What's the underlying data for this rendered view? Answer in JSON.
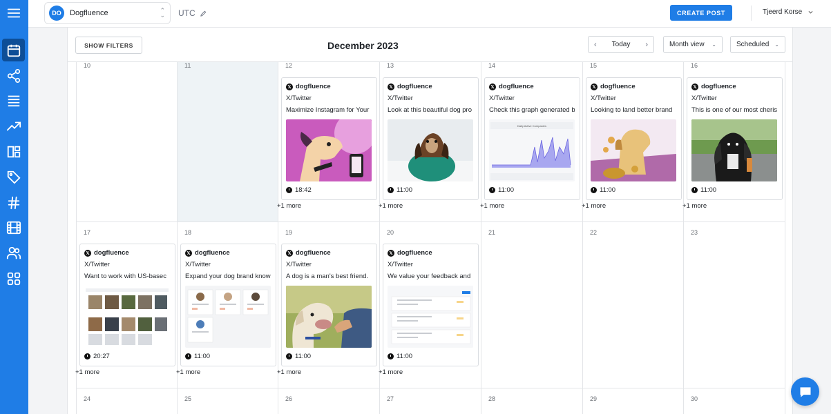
{
  "workspace": {
    "initials": "DO",
    "name": "Dogfluence"
  },
  "timezone": "UTC",
  "create_post_label": "CREATE POST",
  "user_name": "Tjeerd Korse",
  "header": {
    "show_filters": "SHOW FILTERS",
    "month_title": "December 2023",
    "today_label": "Today",
    "view_label": "Month view",
    "status_label": "Scheduled"
  },
  "weeks": [
    {
      "days": [
        {
          "num": "10"
        },
        {
          "num": "11",
          "today": true
        },
        {
          "num": "12",
          "post": {
            "account": "dogfluence",
            "network": "X/Twitter",
            "text": "Maximize Instagram for Your",
            "thumb": "pink-dog-phone",
            "time": "18:42"
          },
          "more": "+1 more"
        },
        {
          "num": "13",
          "post": {
            "account": "dogfluence",
            "network": "X/Twitter",
            "text": "Look at this beautiful dog pro",
            "thumb": "dachshund-sweater",
            "time": "11:00"
          },
          "more": "+1 more"
        },
        {
          "num": "14",
          "post": {
            "account": "dogfluence",
            "network": "X/Twitter",
            "text": "Check this graph generated b",
            "thumb": "graph",
            "time": "11:00"
          },
          "more": "+1 more"
        },
        {
          "num": "15",
          "post": {
            "account": "dogfluence",
            "network": "X/Twitter",
            "text": "Looking to land better brand",
            "thumb": "pink-dog-coins",
            "time": "11:00"
          },
          "more": "+1 more"
        },
        {
          "num": "16",
          "post": {
            "account": "dogfluence",
            "network": "X/Twitter",
            "text": "This is one of our most cheris",
            "thumb": "spaniel-road",
            "time": "11:00"
          },
          "more": "+1 more"
        }
      ]
    },
    {
      "days": [
        {
          "num": "17",
          "post": {
            "account": "dogfluence",
            "network": "X/Twitter",
            "text": "Want to work with US-basec",
            "thumb": "dog-grid",
            "time": "20:27"
          },
          "more": "+1 more"
        },
        {
          "num": "18",
          "post": {
            "account": "dogfluence",
            "network": "X/Twitter",
            "text": "Expand your dog brand know",
            "thumb": "profiles",
            "time": "11:00"
          },
          "more": "+1 more"
        },
        {
          "num": "19",
          "post": {
            "account": "dogfluence",
            "network": "X/Twitter",
            "text": "A dog is a man's best friend.",
            "thumb": "lab-hand",
            "time": "11:00"
          },
          "more": "+1 more"
        },
        {
          "num": "20",
          "post": {
            "account": "dogfluence",
            "network": "X/Twitter",
            "text": "We value your feedback and",
            "thumb": "feedback",
            "time": "11:00"
          },
          "more": "+1 more"
        },
        {
          "num": "21"
        },
        {
          "num": "22"
        },
        {
          "num": "23"
        }
      ]
    },
    {
      "days": [
        {
          "num": "24"
        },
        {
          "num": "25"
        },
        {
          "num": "26"
        },
        {
          "num": "27"
        },
        {
          "num": "28"
        },
        {
          "num": "29"
        },
        {
          "num": "30"
        }
      ]
    }
  ],
  "sidebar_icons": [
    "menu-icon",
    "calendar-icon",
    "share-icon",
    "list-icon",
    "trending-icon",
    "layout-icon",
    "tag-icon",
    "hashtag-icon",
    "film-icon",
    "users-icon",
    "grid-icon"
  ],
  "colors": {
    "brand": "#1f7de6",
    "rail_active": "#0d4e97",
    "today_bg": "#eef3f6"
  }
}
